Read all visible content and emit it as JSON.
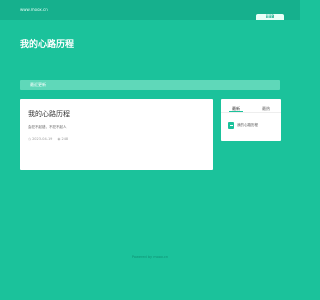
{
  "topbar": {
    "site_url": "www.moox.cn",
    "badge": "iiiiB"
  },
  "page": {
    "heading": "我的心路历程"
  },
  "notice": {
    "label": "最近更新"
  },
  "post": {
    "title": "我的心路历程",
    "excerpt": "会犯不起错，不犯不起人",
    "date": "2023-04-19",
    "views": "248",
    "date_icon": "clock-icon",
    "views_icon": "eye-icon"
  },
  "sidebar": {
    "tabs": [
      {
        "label": "最新"
      },
      {
        "label": "最热"
      }
    ],
    "items": [
      {
        "label": "我的心路历程"
      }
    ]
  },
  "footer": {
    "text": "Powered by moox.cn"
  },
  "colors": {
    "background": "#1bc29b",
    "topbar": "#16b08d",
    "notice": "#5fd8b9",
    "card": "#ffffff"
  }
}
